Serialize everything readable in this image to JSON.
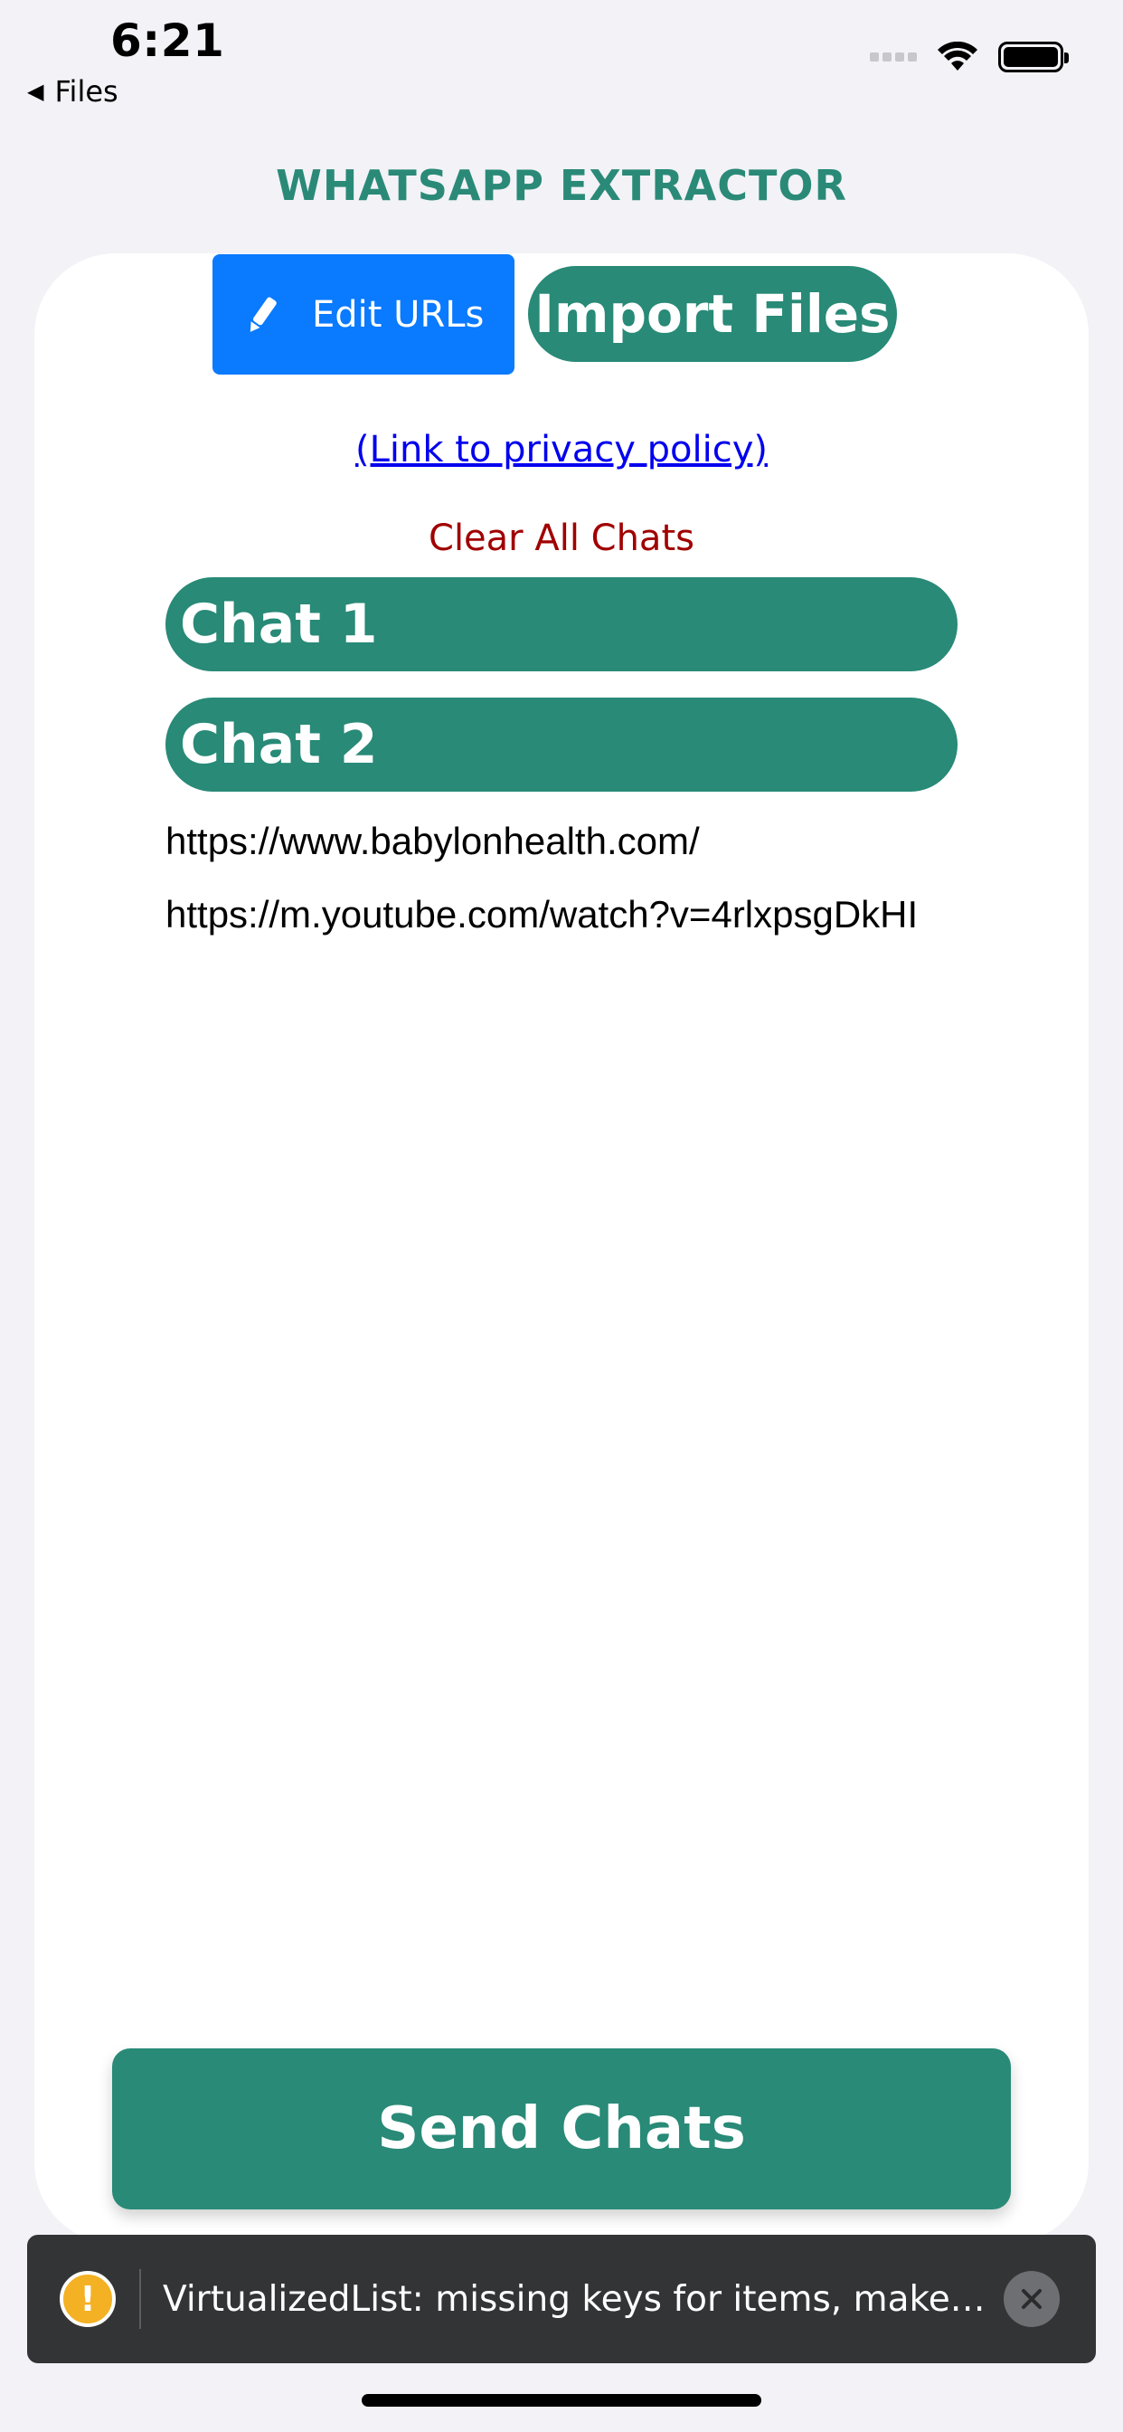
{
  "status_bar": {
    "time": "6:21",
    "back_label": "Files",
    "back_icon": "left-triangle-icon",
    "signal_icon": "cellular-dots-icon",
    "wifi_icon": "wifi-icon",
    "battery_icon": "battery-icon"
  },
  "header": {
    "title": "WHATSAPP EXTRACTOR"
  },
  "actions": {
    "edit_urls_label": "Edit URLs",
    "edit_icon": "pencil-icon",
    "import_files_label": "Import Files"
  },
  "links": {
    "privacy_policy": "(Link to privacy policy)",
    "clear_all_chats": "Clear All Chats"
  },
  "chats": [
    {
      "label": "Chat 1"
    },
    {
      "label": "Chat 2"
    }
  ],
  "urls": [
    "https://www.babylonhealth.com/",
    "https://m.youtube.com/watch?v=4rlxpsgDkHI"
  ],
  "footer": {
    "send_label": "Send Chats"
  },
  "toast": {
    "message": "VirtualizedList: missing keys for items, make…",
    "warning_icon": "warning-icon",
    "close_icon": "close-icon"
  },
  "colors": {
    "accent": "#288a77",
    "edit_button": "#0a7aff",
    "clear_text": "#a00000",
    "link": "#0000ee",
    "background": "#f2f2f7",
    "toast_bg": "#333436"
  }
}
